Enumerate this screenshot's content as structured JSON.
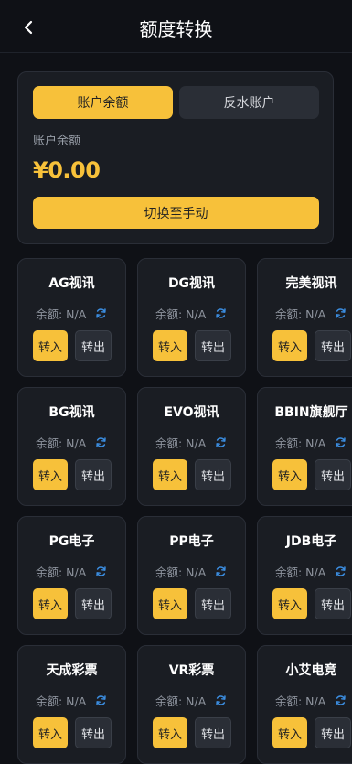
{
  "header": {
    "title": "额度转换",
    "back_icon": "chevron-left-icon"
  },
  "balance": {
    "tabs": [
      "账户余额",
      "反水账户"
    ],
    "label": "账户余额",
    "amount": "¥0.00",
    "switch_label": "切换至手动"
  },
  "colors": {
    "accent": "#f7c13a",
    "background": "#0f1116",
    "card": "#1a1d23",
    "refresh": "#3b8de0"
  },
  "platforms": [
    {
      "name": "AG视讯",
      "balance": "余额: N/A",
      "in": "转入",
      "out": "转出"
    },
    {
      "name": "DG视讯",
      "balance": "余额: N/A",
      "in": "转入",
      "out": "转出"
    },
    {
      "name": "完美视讯",
      "balance": "余额: N/A",
      "in": "转入",
      "out": "转出"
    },
    {
      "name": "BG视讯",
      "balance": "余额: N/A",
      "in": "转入",
      "out": "转出"
    },
    {
      "name": "EVO视讯",
      "balance": "余额: N/A",
      "in": "转入",
      "out": "转出"
    },
    {
      "name": "BBIN旗舰厅",
      "balance": "余额: N/A",
      "in": "转入",
      "out": "转出"
    },
    {
      "name": "PG电子",
      "balance": "余额: N/A",
      "in": "转入",
      "out": "转出"
    },
    {
      "name": "PP电子",
      "balance": "余额: N/A",
      "in": "转入",
      "out": "转出"
    },
    {
      "name": "JDB电子",
      "balance": "余额: N/A",
      "in": "转入",
      "out": "转出"
    },
    {
      "name": "天成彩票",
      "balance": "余额: N/A",
      "in": "转入",
      "out": "转出"
    },
    {
      "name": "VR彩票",
      "balance": "余额: N/A",
      "in": "转入",
      "out": "转出"
    },
    {
      "name": "小艾电竞",
      "balance": "余额: N/A",
      "in": "转入",
      "out": "转出"
    }
  ]
}
